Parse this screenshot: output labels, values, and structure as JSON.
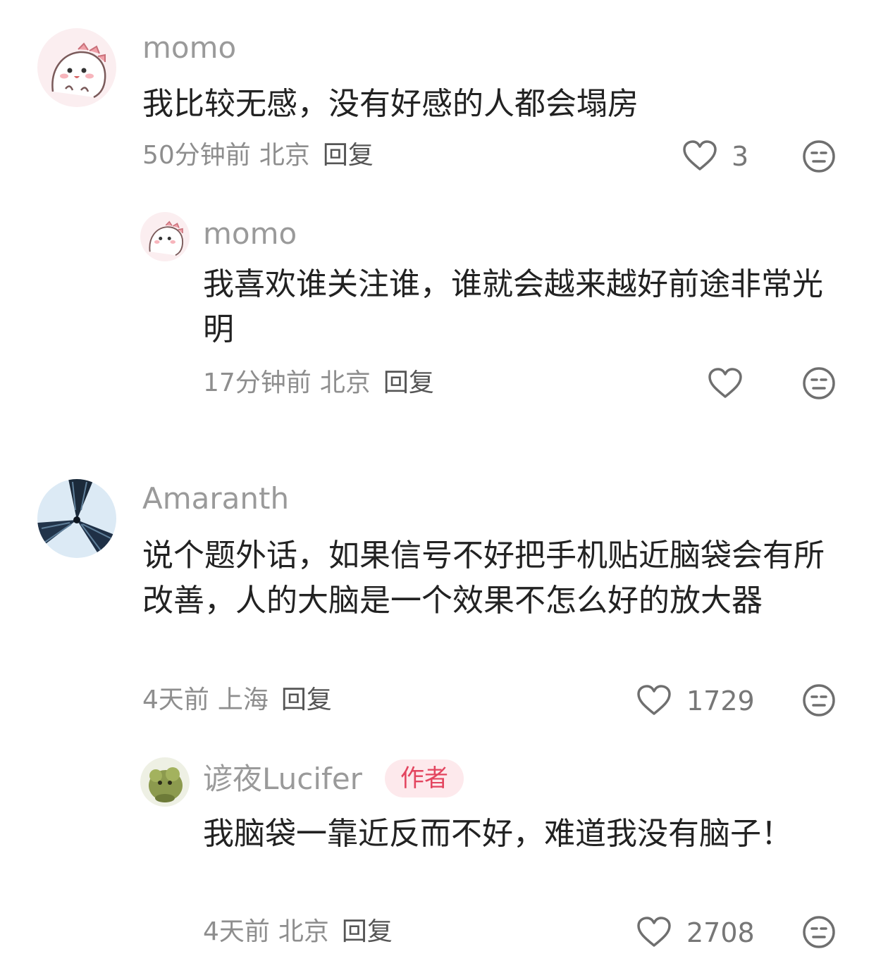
{
  "comments": [
    {
      "username": "momo",
      "text": "我比较无感，没有好感的人都会塌房",
      "time": "50分钟前",
      "location": "北京",
      "reply_label": "回复",
      "likes": "3",
      "replies": [
        {
          "username": "momo",
          "text": "我喜欢谁关注谁，谁就会越来越好前途非常光明",
          "time": "17分钟前",
          "location": "北京",
          "reply_label": "回复",
          "likes": ""
        }
      ]
    },
    {
      "username": "Amaranth",
      "text": "说个题外话，如果信号不好把手机贴近脑袋会有所改善，人的大脑是一个效果不怎么好的放大器",
      "time": "4天前",
      "location": "上海",
      "reply_label": "回复",
      "likes": "1729",
      "replies": [
        {
          "username": "谚夜Lucifer",
          "badge": "作者",
          "text": "我脑袋一靠近反而不好，难道我没有脑子！",
          "time": "4天前",
          "location": "北京",
          "reply_label": "回复",
          "likes": "2708"
        }
      ]
    }
  ],
  "icons": {
    "like": "heart-outline-icon",
    "dislike": "meh-face-icon"
  },
  "colors": {
    "username": "#9a9a9a",
    "text": "#222222",
    "meta": "#8e8e8e",
    "badge_bg": "#fde9ec",
    "badge_text": "#e3455f"
  }
}
